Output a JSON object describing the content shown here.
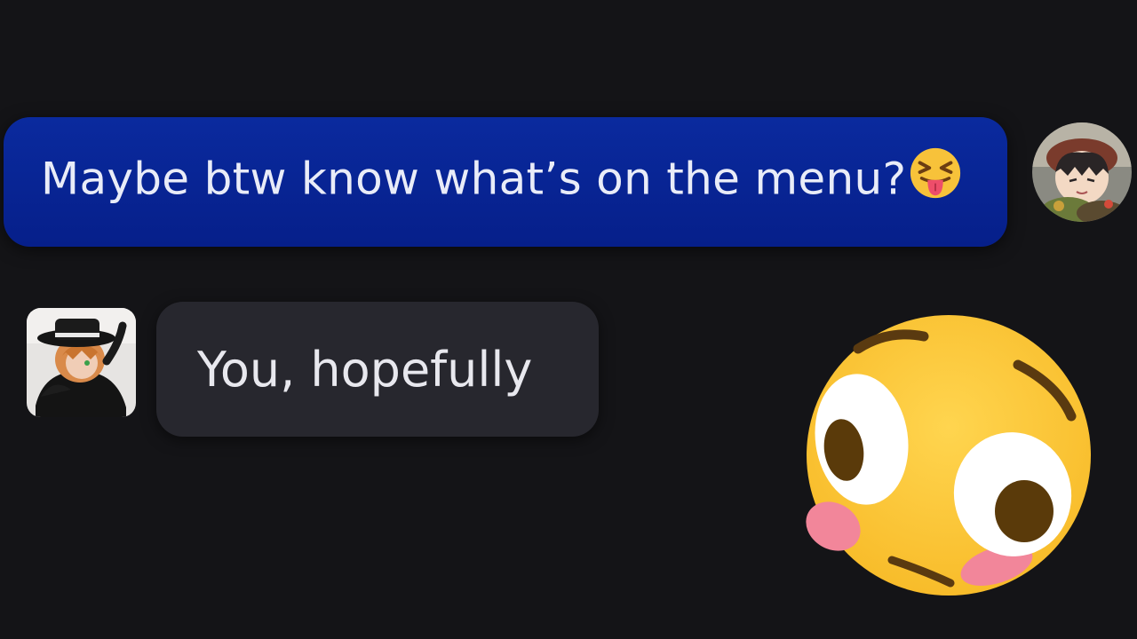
{
  "messages": {
    "outgoing": {
      "text": "Maybe btw know what’s on the menu?",
      "emoji": "squinting-face-with-tongue",
      "bubble_color": "#061f8a"
    },
    "incoming": {
      "text": "You, hopefully",
      "bubble_color": "#27272e"
    }
  },
  "avatars": {
    "right": "avatar-anime-character-brown-hat",
    "left": "avatar-anime-character-black-hat"
  },
  "overlay": {
    "emoji": "flushed-face-icon"
  },
  "colors": {
    "background": "#141417",
    "text": "#e9ecf8",
    "emoji_yellow": "#fcc63a"
  }
}
